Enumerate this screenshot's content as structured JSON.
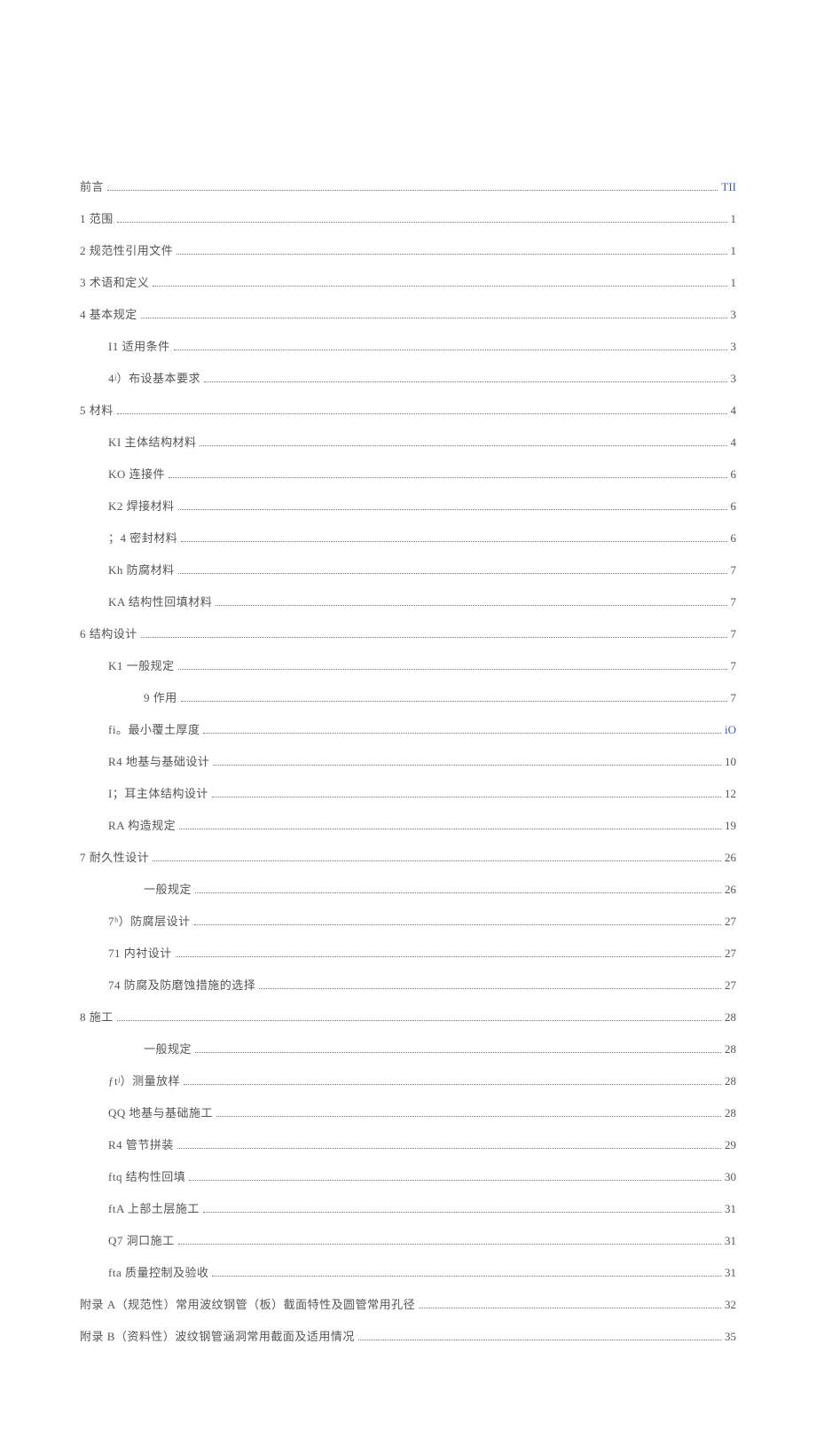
{
  "toc": [
    {
      "label": "前言",
      "page": "TII",
      "indent": 0,
      "pageBlue": true
    },
    {
      "label": "1 范围",
      "page": "1",
      "indent": 0
    },
    {
      "label": "2 规范性引用文件",
      "page": "1",
      "indent": 0
    },
    {
      "label": "3 术语和定义",
      "page": "1",
      "indent": 0
    },
    {
      "label": "4 基本规定",
      "page": "3",
      "indent": 0
    },
    {
      "label": "I1 适用条件",
      "page": "3",
      "indent": 1
    },
    {
      "label": "4ʲ）布设基本要求",
      "page": "3",
      "indent": 1
    },
    {
      "label": "5 材料",
      "page": "4",
      "indent": 0
    },
    {
      "label": "KI       主体结构材料",
      "page": "4",
      "indent": 1
    },
    {
      "label": "KO 连接件",
      "page": "6",
      "indent": 1
    },
    {
      "label": "K2 焊接材料",
      "page": "6",
      "indent": 1
    },
    {
      "label": "；4 密封材料",
      "page": "6",
      "indent": 1
    },
    {
      "label": "Kh 防腐材料",
      "page": "7",
      "indent": 1
    },
    {
      "label": "KA 结构性回填材料",
      "page": "7",
      "indent": 1
    },
    {
      "label": "6 结构设计",
      "page": "7",
      "indent": 0
    },
    {
      "label": "K1 一般规定",
      "page": "7",
      "indent": 1
    },
    {
      "label": "9 作用",
      "page": "7",
      "indent": 2
    },
    {
      "label": "fi。最小覆土厚度",
      "page": "iO",
      "indent": 1,
      "pageBlue": true
    },
    {
      "label": "R4 地基与基础设计",
      "page": "10",
      "indent": 1
    },
    {
      "label": "I；耳主体结构设计",
      "page": "12",
      "indent": 1
    },
    {
      "label": "RA 构造规定",
      "page": "19",
      "indent": 1
    },
    {
      "label": "7 耐久性设计",
      "page": "26",
      "indent": 0
    },
    {
      "label": "一般规定",
      "page": "26",
      "indent": 2
    },
    {
      "label": "7ʰ）防腐层设计",
      "page": "27",
      "indent": 1
    },
    {
      "label": "71 内衬设计",
      "page": "27",
      "indent": 1
    },
    {
      "label": "74 防腐及防磨蚀措施的选择",
      "page": "27",
      "indent": 1
    },
    {
      "label": "8 施工",
      "page": "28",
      "indent": 0
    },
    {
      "label": "一般规定",
      "page": "28",
      "indent": 2
    },
    {
      "label": "ƒtʲ）测量放样",
      "page": "28",
      "indent": 1
    },
    {
      "label": "QQ 地基与基础施工",
      "page": "28",
      "indent": 1
    },
    {
      "label": "R4 管节拼装",
      "page": "29",
      "indent": 1
    },
    {
      "label": "ftq 结构性回填",
      "page": "30",
      "indent": 1
    },
    {
      "label": "ftA 上部土层施工",
      "page": "31",
      "indent": 1
    },
    {
      "label": "Q7 洞口施工",
      "page": "31",
      "indent": 1
    },
    {
      "label": "fta 质量控制及验收",
      "page": "31",
      "indent": 1
    },
    {
      "label": "附录 A（规范性）常用波纹钢管（板）截面特性及圆管常用孔径",
      "page": "32",
      "indent": 0
    },
    {
      "label": "附录 B（资料性）波纹钢管涵洞常用截面及适用情况",
      "page": "35",
      "indent": 0
    }
  ]
}
